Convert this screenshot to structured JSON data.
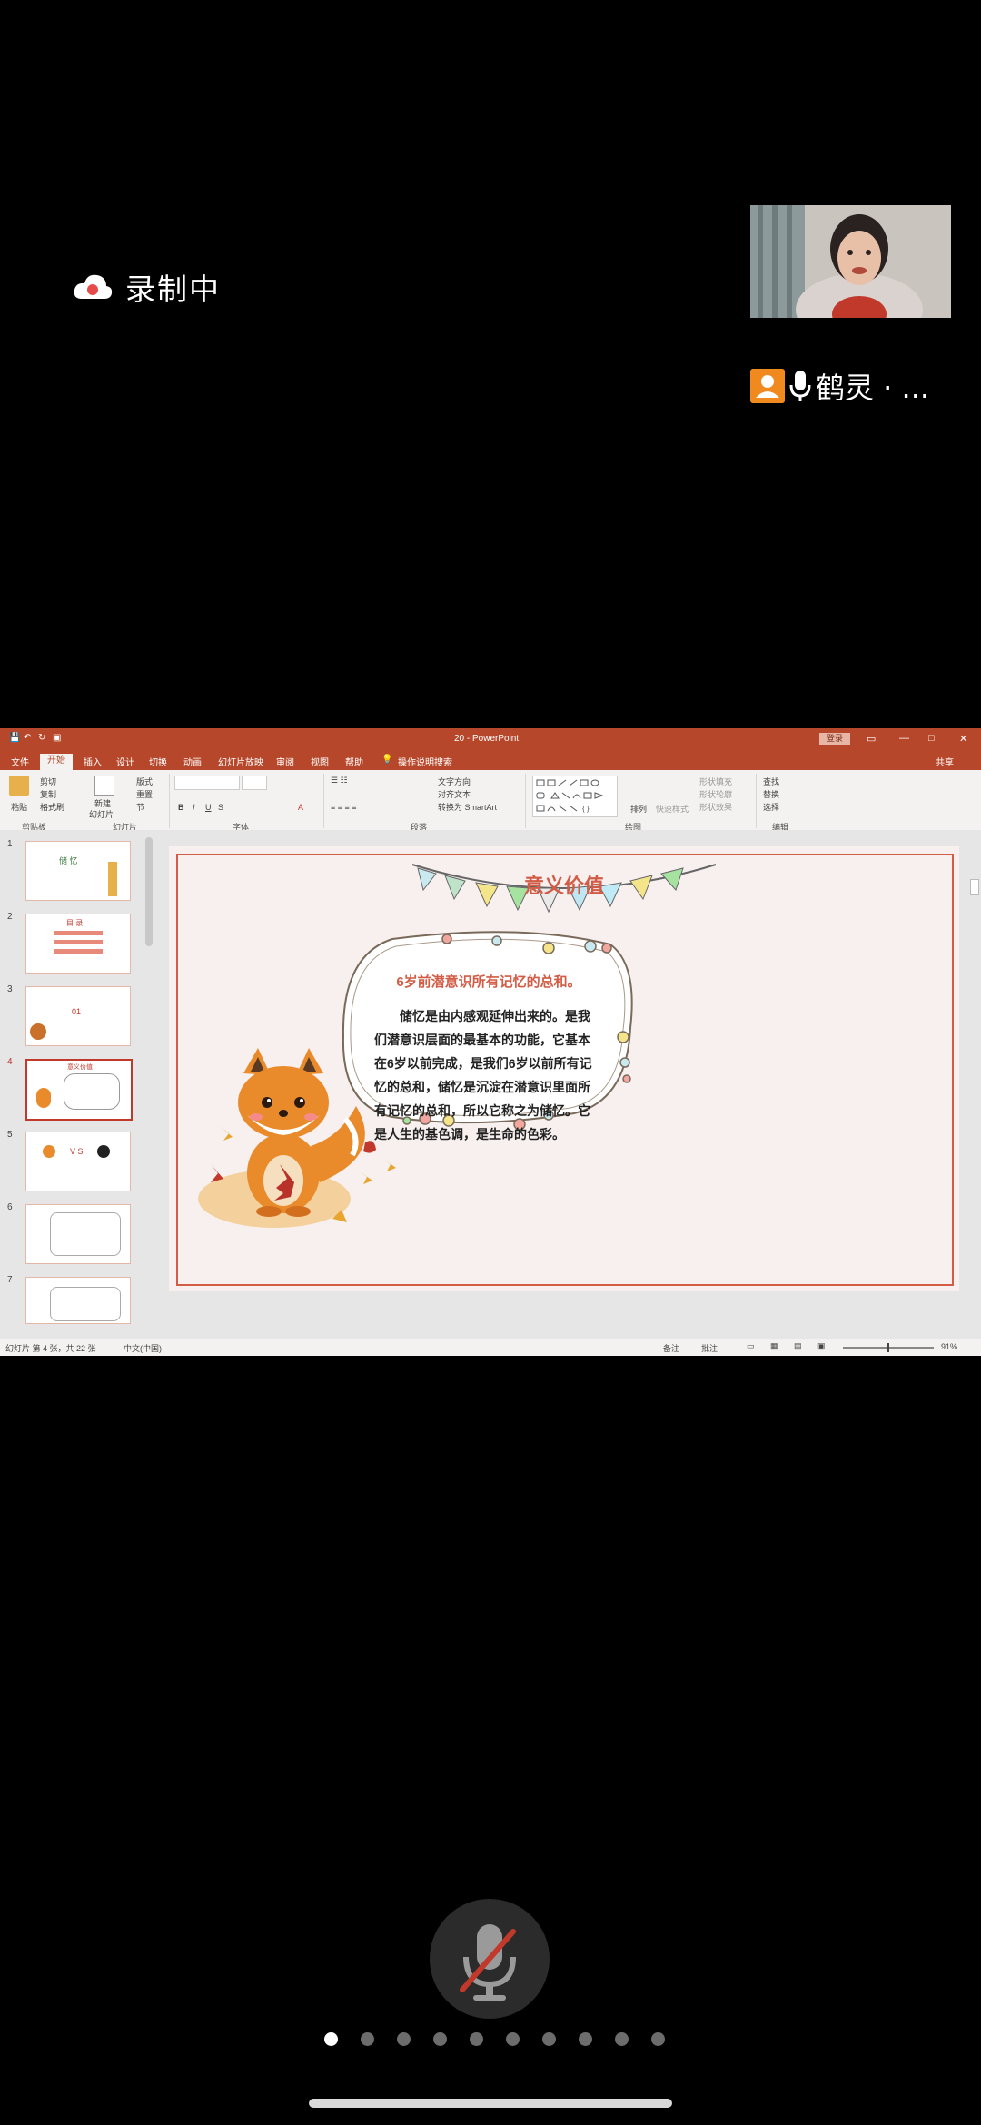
{
  "recording": {
    "label": "录制中",
    "icon": "cloud-record-icon"
  },
  "participant": {
    "name": "鹤灵 · ...",
    "avatar_icon": "person-icon",
    "mic_icon": "microphone-icon"
  },
  "ppt": {
    "window_title": "20 - PowerPoint",
    "login_label": "登录",
    "tabs": [
      "文件",
      "开始",
      "插入",
      "设计",
      "切换",
      "动画",
      "幻灯片放映",
      "审阅",
      "视图",
      "帮助"
    ],
    "tell_me": "操作说明搜索",
    "share": "共享",
    "ribbon": {
      "clipboard": {
        "paste": "粘贴",
        "cut": "剪切",
        "copy": "复制",
        "format_painter": "格式刷",
        "group": "剪贴板"
      },
      "slides": {
        "new_slide": "新建",
        "new_slide2": "幻灯片",
        "layout": "版式",
        "reset": "重置",
        "section": "节",
        "group": "幻灯片"
      },
      "font": {
        "group": "字体"
      },
      "paragraph": {
        "text_direction": "文字方向",
        "align_text": "对齐文本",
        "smartart": "转换为 SmartArt",
        "group": "段落"
      },
      "drawing": {
        "arrange": "排列",
        "quick_styles": "快速样式",
        "fill": "形状填充",
        "outline": "形状轮廓",
        "effects": "形状效果",
        "group": "绘图"
      },
      "editing": {
        "find": "查找",
        "replace": "替换",
        "select": "选择",
        "group": "编辑"
      }
    },
    "thumbnails": [
      {
        "num": "1",
        "title": "储 忆"
      },
      {
        "num": "2",
        "title": "目 录"
      },
      {
        "num": "3",
        "title": "01"
      },
      {
        "num": "4",
        "title": "意义价值"
      },
      {
        "num": "5",
        "title": "V S"
      },
      {
        "num": "6",
        "title": ""
      },
      {
        "num": "7",
        "title": ""
      }
    ],
    "slide": {
      "title": "意义价值",
      "subtitle": "6岁前潜意识所有记忆的总和。",
      "body": "储忆是由内感观延伸出来的。是我们潜意识层面的最基本的功能，它基本在6岁以前完成，是我们6岁以前所有记忆的总和，储忆是沉淀在潜意识里面所有记忆的总和，所以它称之为储忆。它是人生的基色调，是生命的色彩。"
    },
    "status": {
      "slide_info": "幻灯片 第 4 张，共 22 张",
      "language": "中文(中国)",
      "notes": "备注",
      "comments": "批注",
      "zoom": "91%"
    }
  },
  "pager": {
    "count": 10,
    "active": 0
  },
  "colors": {
    "accent": "#b7472a",
    "slide_title": "#d25c45"
  }
}
